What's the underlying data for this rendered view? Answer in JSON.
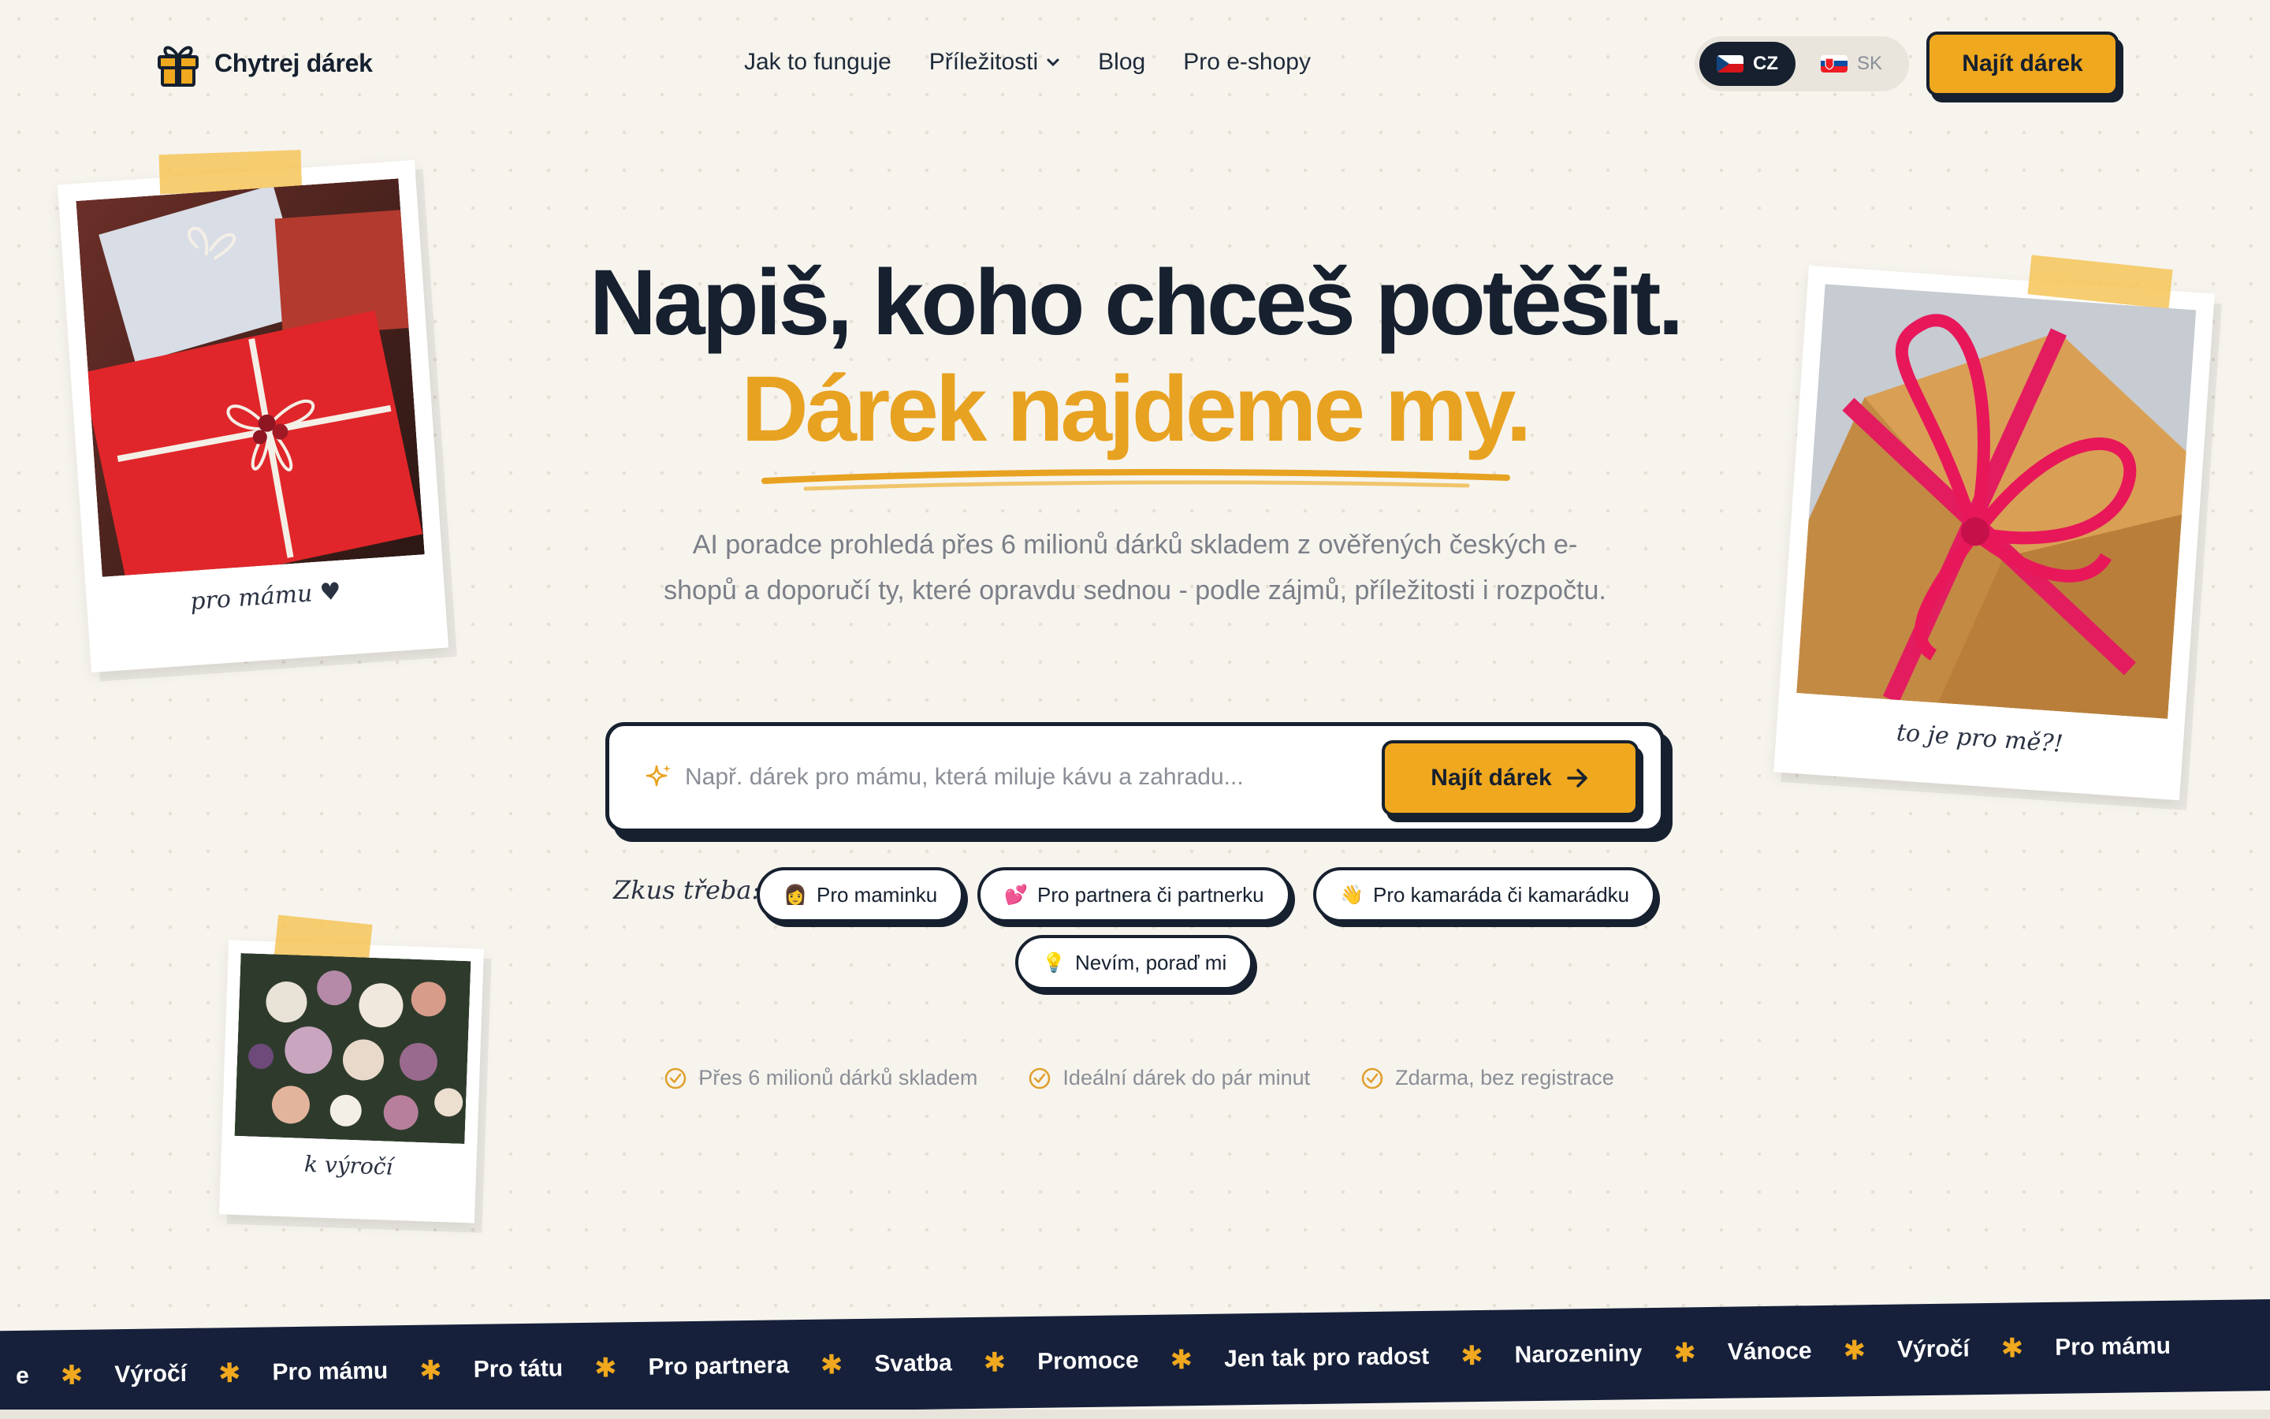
{
  "brand": {
    "name": "Chytrej dárek",
    "accent": "#f0a81e",
    "ink": "#16202f"
  },
  "nav": {
    "items": [
      {
        "label": "Jak to funguje"
      },
      {
        "label": "Příležitosti"
      },
      {
        "label": "Blog"
      },
      {
        "label": "Pro e-shopy"
      }
    ]
  },
  "lang": {
    "active": "CZ",
    "inactive": "SK"
  },
  "header_cta": "Najít dárek",
  "hero": {
    "title_line1": "Napiš, koho chceš potěšit.",
    "title_line2": "Dárek najdeme my.",
    "subtitle": "AI poradce prohledá přes 6 milionů dárků skladem z ověřených českých e-shopů a doporučí ty, které opravdu sednou - podle zájmů, příležitosti i rozpočtu."
  },
  "search": {
    "placeholder": "Např. dárek pro mámu, která miluje kávu a zahradu...",
    "value": "",
    "button": "Najít dárek"
  },
  "suggestions": {
    "label": "Zkus třeba:",
    "chips": [
      {
        "emoji": "👩",
        "label": "Pro maminku"
      },
      {
        "emoji": "💕",
        "label": "Pro partnera či partnerku"
      },
      {
        "emoji": "👋",
        "label": "Pro kamaráda či kamarádku"
      },
      {
        "emoji": "💡",
        "label": "Nevím, poraď mi"
      }
    ]
  },
  "features": [
    "Přes 6 milionů dárků skladem",
    "Ideální dárek do pár minut",
    "Zdarma, bez registrace"
  ],
  "polaroids": [
    {
      "caption": "pro mámu ♥"
    },
    {
      "caption": "to je pro mě?!"
    },
    {
      "caption": "k výročí"
    }
  ],
  "ticker": [
    "e",
    "Výročí",
    "Pro mámu",
    "Pro tátu",
    "Pro partnera",
    "Svatba",
    "Promoce",
    "Jen tak pro radost",
    "Narozeniny",
    "Vánoce",
    "Výročí",
    "Pro mámu"
  ]
}
